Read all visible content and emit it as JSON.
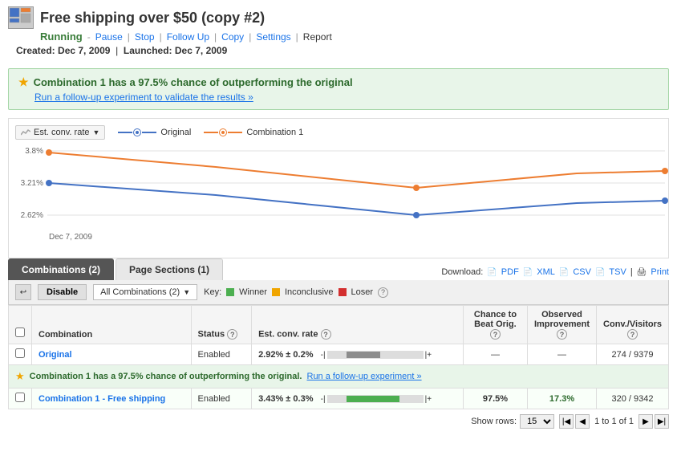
{
  "header": {
    "title": "Free shipping over $50 (copy #2)",
    "status": "Running",
    "status_actions": [
      {
        "label": "Pause",
        "href": "#"
      },
      {
        "label": "Stop",
        "href": "#"
      },
      {
        "label": "Follow Up",
        "href": "#"
      },
      {
        "label": "Copy",
        "href": "#"
      },
      {
        "label": "Settings",
        "href": "#"
      },
      {
        "label": "Report",
        "href": "#"
      }
    ],
    "created": "Dec 7, 2009",
    "launched": "Dec 7, 2009"
  },
  "notification": {
    "text": "Combination 1 has a 97.5% chance of outperforming the original",
    "link_text": "Run a follow-up experiment to validate the results »"
  },
  "chart": {
    "y_axis": [
      "3.8%",
      "3.21%",
      "2.62%"
    ],
    "x_label": "Dec 7, 2009",
    "dropdown_label": "Est. conv. rate",
    "legend": [
      {
        "label": "Original",
        "color": "#4472C4"
      },
      {
        "label": "Combination 1",
        "color": "#ED7D31"
      }
    ]
  },
  "tabs": [
    {
      "label": "Combinations (2)",
      "active": true
    },
    {
      "label": "Page Sections (1)",
      "active": false
    }
  ],
  "download": {
    "label": "Download:",
    "links": [
      "PDF",
      "XML",
      "CSV",
      "TSV",
      "Print"
    ]
  },
  "toolbar": {
    "disable_label": "Disable",
    "combos_label": "All Combinations (2)",
    "key_label": "Key:",
    "key_items": [
      {
        "label": "Winner",
        "color": "#4caf50"
      },
      {
        "label": "Inconclusive",
        "color": "#f0a500"
      },
      {
        "label": "Loser",
        "color": "#d32f2f"
      }
    ]
  },
  "table": {
    "headers": [
      {
        "label": "Combination"
      },
      {
        "label": "Status"
      },
      {
        "label": "Est. conv. rate"
      },
      {
        "label": "Chance to Beat Orig."
      },
      {
        "label": "Observed Improvement"
      },
      {
        "label": "Conv./Visitors"
      }
    ],
    "rows": [
      {
        "id": "original",
        "label": "Original",
        "link": true,
        "status": "Enabled",
        "rate": "2.92% ± 0.2%",
        "chance": "—",
        "improvement": "—",
        "conv_visitors": "274 / 9379",
        "bar_type": "neutral"
      },
      {
        "id": "combo1",
        "label": "Combination 1 - Free shipping",
        "link": true,
        "status": "Enabled",
        "rate": "3.43% ± 0.3%",
        "chance": "97.5%",
        "improvement": "17.3%",
        "conv_visitors": "320 / 9342",
        "bar_type": "green",
        "notification": "Combination 1 has a 97.5% chance of outperforming the original.",
        "notif_link": "Run a follow-up experiment »"
      }
    ]
  },
  "pagination": {
    "show_rows_label": "Show rows:",
    "rows_value": "15",
    "page_info": "1 to 1 of 1"
  }
}
